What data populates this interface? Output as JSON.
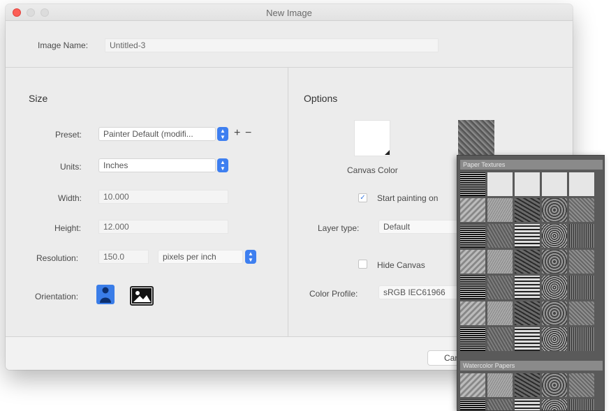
{
  "window": {
    "title": "New Image"
  },
  "image_name": {
    "label": "Image Name:",
    "value": "Untitled-3"
  },
  "size": {
    "title": "Size",
    "preset_label": "Preset:",
    "preset_value": "Painter Default (modifi...",
    "add_symbol": "+",
    "remove_symbol": "−",
    "units_label": "Units:",
    "units_value": "Inches",
    "width_label": "Width:",
    "width_value": "10.000",
    "height_label": "Height:",
    "height_value": "12.000",
    "resolution_label": "Resolution:",
    "resolution_value": "150.0",
    "resolution_units": "pixels per inch",
    "orientation_label": "Orientation:"
  },
  "options": {
    "title": "Options",
    "canvas_color_label": "Canvas Color",
    "start_painting_label": "Start painting on",
    "start_painting_checked": true,
    "layer_type_label": "Layer type:",
    "layer_type_value": "Default",
    "hide_canvas_label": "Hide Canvas",
    "hide_canvas_checked": false,
    "color_profile_label": "Color Profile:",
    "color_profile_value": "sRGB IEC61966"
  },
  "footer": {
    "cancel_label": "Can"
  },
  "paper_popup": {
    "section1_title": "Paper Textures",
    "section2_title": "Watercolor Papers"
  },
  "colors": {
    "accent": "#3e7ff0",
    "close": "#fc5f57"
  }
}
